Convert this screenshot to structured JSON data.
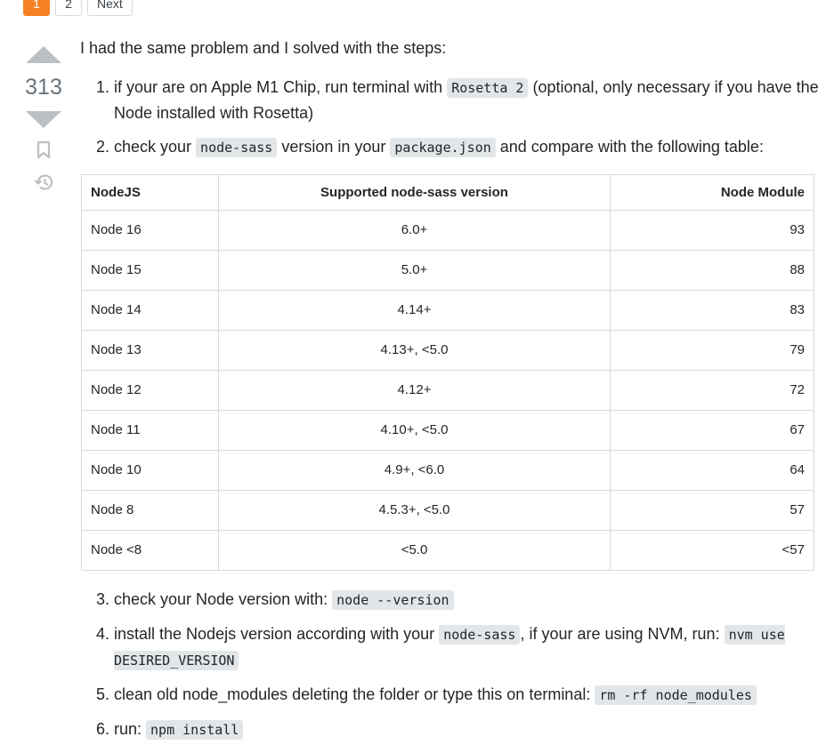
{
  "pager": {
    "pages": [
      "1",
      "2"
    ],
    "next_label": "Next"
  },
  "votes": {
    "count": "313"
  },
  "icons": {
    "up": "vote-up-icon",
    "down": "vote-down-icon",
    "bookmark": "bookmark-icon",
    "history": "history-icon"
  },
  "post": {
    "intro": "I had the same problem and I solved with the steps:",
    "step1": {
      "pre": "if your are on Apple M1 Chip, run terminal with ",
      "code": "Rosetta 2",
      "post": " (optional, only necessary if you have the Node installed with Rosetta)"
    },
    "step2": {
      "pre": "check your ",
      "code1": "node-sass",
      "mid": " version in your ",
      "code2": "package.json",
      "post": " and compare with the following table:"
    },
    "table": {
      "headers": [
        "NodeJS",
        "Supported node-sass version",
        "Node Module"
      ],
      "rows": [
        [
          "Node 16",
          "6.0+",
          "93"
        ],
        [
          "Node 15",
          "5.0+",
          "88"
        ],
        [
          "Node 14",
          "4.14+",
          "83"
        ],
        [
          "Node 13",
          "4.13+, <5.0",
          "79"
        ],
        [
          "Node 12",
          "4.12+",
          "72"
        ],
        [
          "Node 11",
          "4.10+, <5.0",
          "67"
        ],
        [
          "Node 10",
          "4.9+, <6.0",
          "64"
        ],
        [
          "Node 8",
          "4.5.3+, <5.0",
          "57"
        ],
        [
          "Node <8",
          "<5.0",
          "<57"
        ]
      ]
    },
    "step3": {
      "pre": "check your Node version with: ",
      "code": "node --version"
    },
    "step4": {
      "pre": "install the Nodejs version according with your ",
      "code1": "node-sass",
      "mid": ", if your are using NVM, run: ",
      "code2": "nvm use DESIRED_VERSION"
    },
    "step5": {
      "pre": "clean old node_modules deleting the folder or type this on terminal: ",
      "code": "rm -rf node_modules"
    },
    "step6": {
      "pre": "run: ",
      "code": "npm install"
    }
  },
  "colors": {
    "accent": "#f48225",
    "vote_gray": "#bbc0c4",
    "code_bg": "#e3e6e8"
  }
}
